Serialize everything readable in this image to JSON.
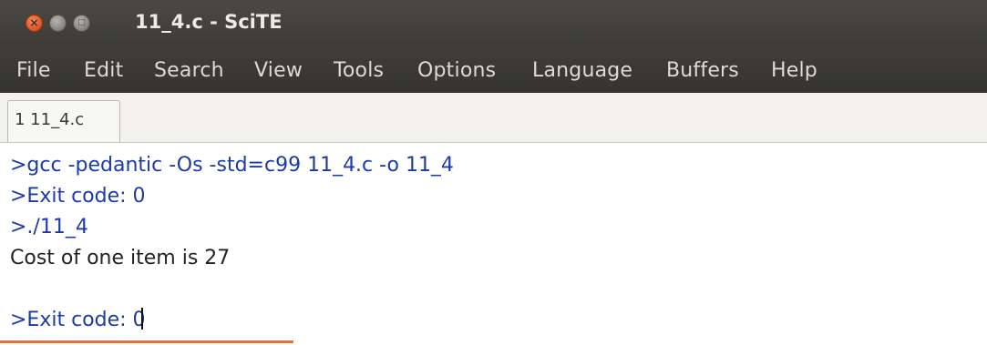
{
  "window": {
    "title": "11_4.c - SciTE",
    "controls": {
      "close_glyph": "×",
      "minimize_glyph": "",
      "maximize_glyph": "□"
    }
  },
  "menubar": {
    "items": [
      "File",
      "Edit",
      "Search",
      "View",
      "Tools",
      "Options",
      "Language",
      "Buffers",
      "Help"
    ]
  },
  "tabs": [
    {
      "label": "1 11_4.c"
    }
  ],
  "output": {
    "lines": [
      {
        "text": ">gcc -pedantic -Os -std=c99 11_4.c -o 11_4",
        "kind": "command"
      },
      {
        "text": ">Exit code: 0",
        "kind": "command"
      },
      {
        "text": ">./11_4",
        "kind": "command"
      },
      {
        "text": "Cost of one item is 27",
        "kind": "program"
      },
      {
        "text": "",
        "kind": "program"
      },
      {
        "text": ">Exit code: 0",
        "kind": "command"
      }
    ]
  },
  "colors": {
    "command_text": "#1d3ba8",
    "program_text": "#232323",
    "titlebar": "#3c3b37",
    "close_button": "#e0501e",
    "accent_bar": "#e8713a"
  }
}
